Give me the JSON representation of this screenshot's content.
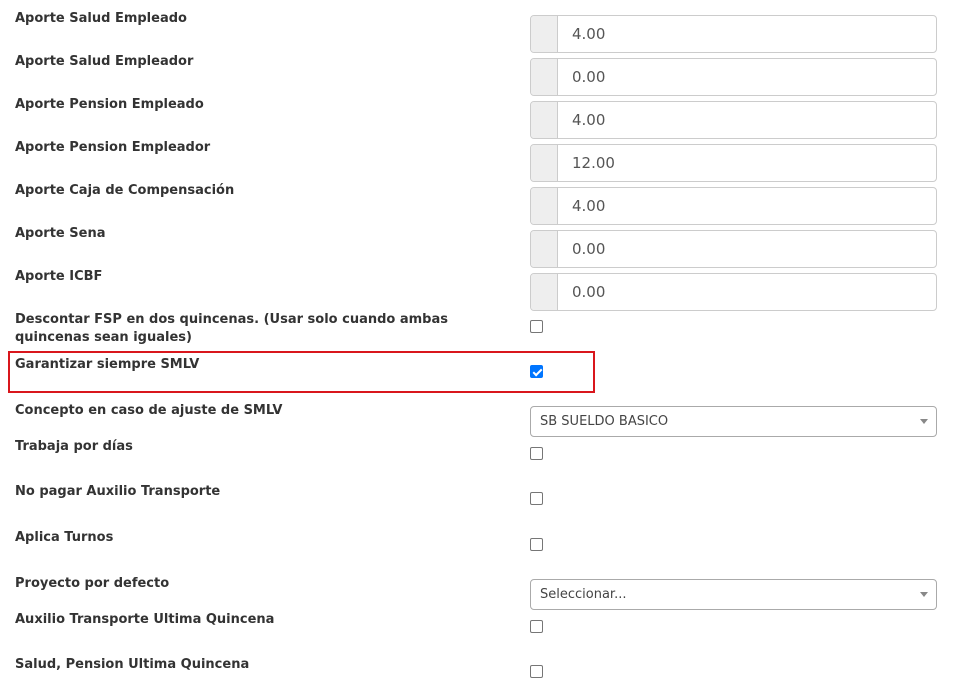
{
  "fields": {
    "aporte_salud_empleado": {
      "label": "Aporte Salud Empleado",
      "value": "4.00"
    },
    "aporte_salud_empleador": {
      "label": "Aporte Salud Empleador",
      "value": "0.00"
    },
    "aporte_pension_empleado": {
      "label": "Aporte Pension Empleado",
      "value": "4.00"
    },
    "aporte_pension_empleador": {
      "label": "Aporte Pension Empleador",
      "value": "12.00"
    },
    "aporte_caja_compensacion": {
      "label": "Aporte Caja de Compensación",
      "value": "4.00"
    },
    "aporte_sena": {
      "label": "Aporte Sena",
      "value": "0.00"
    },
    "aporte_icbf": {
      "label": "Aporte ICBF",
      "value": "0.00"
    }
  },
  "checks": {
    "descontar_fsp": {
      "label": "Descontar FSP en dos quincenas. (Usar solo cuando ambas quincenas sean iguales)",
      "checked": false
    },
    "garantizar_smlv": {
      "label": "Garantizar siempre SMLV",
      "checked": true
    },
    "trabaja_por_dias": {
      "label": "Trabaja por días",
      "checked": false
    },
    "no_pagar_auxilio": {
      "label": "No pagar Auxilio Transporte",
      "checked": false
    },
    "aplica_turnos": {
      "label": "Aplica Turnos",
      "checked": false
    },
    "auxilio_ultima_quincena": {
      "label": "Auxilio Transporte Ultima Quincena",
      "checked": false
    },
    "salud_pension_ultima_quincena": {
      "label": "Salud, Pension Ultima Quincena",
      "checked": false
    }
  },
  "selects": {
    "concepto_ajuste": {
      "label": "Concepto en caso de ajuste de SMLV",
      "value": "SB SUELDO BASICO"
    },
    "proyecto_defecto": {
      "label": "Proyecto por defecto",
      "value": "Seleccionar..."
    }
  },
  "colors": {
    "highlight": "#d9161c",
    "checkbox_checked": "#0075ff"
  }
}
